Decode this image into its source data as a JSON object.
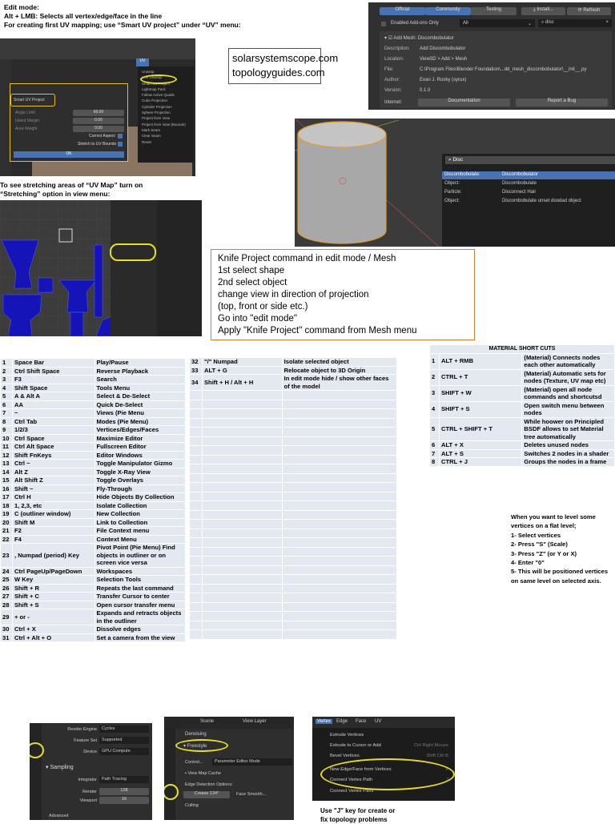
{
  "intro": {
    "line1": "Edit mode:",
    "line2": "Alt + LMB: Selects all vertex/edge/face in the line",
    "line3": "For creating first UV mapping; use  “Smart UV project” under “UV” menu:"
  },
  "uv_shot": {
    "panel_title": "Smart UV Project",
    "fields": [
      {
        "label": "Angle Limit",
        "value": "66.00"
      },
      {
        "label": "Island Margin",
        "value": "0.00"
      },
      {
        "label": "Area Weight",
        "value": "0.00"
      }
    ],
    "correct_aspect": "Correct Aspect",
    "stretch": "Stretch to UV Bounds",
    "ok": "OK",
    "menu": [
      "Unwrap",
      "Live Unwrap",
      "Smart UV Project",
      "Lightmap Pack",
      "Follow Active Quads",
      "Cube Projection",
      "Cylinder Projection",
      "Sphere Projection",
      "Project from View",
      "Project from View (Bounds)",
      "Mark Seam",
      "Clear Seam",
      "Reset"
    ],
    "menu_tab": "UV"
  },
  "links": [
    "solarsystemscope.com",
    "topologyguides.com"
  ],
  "addon": {
    "tabs": [
      "Official",
      "Community",
      "Testing"
    ],
    "install": "Install...",
    "refresh": "Refresh",
    "enabled_only": "Enabled Add-ons Only",
    "filter": "All",
    "search": "disc",
    "name": "Add Mesh: Discombobulator",
    "rows": [
      {
        "k": "Description:",
        "v": "Add Discombobulator"
      },
      {
        "k": "Location:",
        "v": "View3D > Add > Mesh"
      },
      {
        "k": "File:",
        "v": "C:\\Program Files\\Blender Foundation\\...dd_mesh_discombobulator\\__init__.py"
      },
      {
        "k": "Author:",
        "v": "Evan J. Rosky (syrux)"
      },
      {
        "k": "Version:",
        "v": "0.1.0"
      }
    ],
    "internet": "Internet:",
    "doc": "Documentation",
    "bug": "Report a Bug"
  },
  "search_shot": {
    "query": "Disc",
    "results": [
      {
        "k": "Discombobulate:",
        "v": "Discombobulator"
      },
      {
        "k": "Object:",
        "v": "Discombobulate"
      },
      {
        "k": "Particle:",
        "v": "Disconnect Hair"
      },
      {
        "k": "Object:",
        "v": "Discombobulate unset doodad object"
      }
    ]
  },
  "stretch_note": {
    "line1": "To see stretching areas of “UV Map” turn on",
    "line2": "“Stretching” option in view menu:"
  },
  "knife": [
    "Knife Project command in edit mode / Mesh",
    "1st select shape",
    "2nd select object",
    "change view in direction of projection",
    "(top, front or side etc.)",
    "Go into \"edit mode\"",
    "Apply \"Knife Project\" command from Mesh menu"
  ],
  "shortcuts": [
    [
      "1",
      "Space Bar",
      "Play/Pause"
    ],
    [
      "2",
      "Ctrl Shift Space",
      "Reverse Playback"
    ],
    [
      "3",
      "F3",
      "Search"
    ],
    [
      "4",
      "Shift Space",
      "Tools Menu"
    ],
    [
      "5",
      "A & Alt A",
      "Select & De-Select"
    ],
    [
      "6",
      "AA",
      "Quick De-Select"
    ],
    [
      "7",
      "~",
      "Views (Pie Menu"
    ],
    [
      "8",
      "Ctrl Tab",
      "Modes (Pie Menu)"
    ],
    [
      "9",
      "1/2/3",
      "Vertices/Edges/Faces"
    ],
    [
      "10",
      "Ctrl Space",
      "Maximize Editor"
    ],
    [
      "11",
      "Ctrl Alt Space",
      "Fullscreen Editor"
    ],
    [
      "12",
      "Shift FnKeys",
      "Editor Windows"
    ],
    [
      "13",
      "Ctrl ~",
      "Toggle Manipulator Gizmo"
    ],
    [
      "14",
      "Alt Z",
      "Toggle X-Ray View"
    ],
    [
      "15",
      "Alt Shift Z",
      "Toggle Overlays"
    ],
    [
      "16",
      "Shift ~",
      "Fly-Through"
    ],
    [
      "17",
      "Ctrl H",
      "Hide Objects By Collection"
    ],
    [
      "18",
      "1, 2,3, etc",
      "Isolate Collection"
    ],
    [
      "19",
      "C (outliner window)",
      "New Collection"
    ],
    [
      "20",
      "Shift M",
      "Link to Collection"
    ],
    [
      "21",
      "F2",
      "File Context menu"
    ],
    [
      "22",
      "F4",
      "Context Menu"
    ],
    [
      "23",
      ", Numpad (period) Key",
      "Pivot Point (Pie Menu) Find objects in outliner or on screen vice versa"
    ],
    [
      "24",
      "Ctrl PageUp/PageDown",
      "Workspaces"
    ],
    [
      "25",
      "W Key",
      "Selection Tools"
    ],
    [
      "26",
      "Shift + R",
      "Repeats the last command"
    ],
    [
      "27",
      "Shift + C",
      "Transfer Cursor to center"
    ],
    [
      "28",
      "Shift + S",
      "Open cursor transfer menu"
    ],
    [
      "29",
      "+ or -",
      "Expands and retracts objects in the outliner"
    ],
    [
      "30",
      "Ctrl + X",
      "Dissolve edges"
    ],
    [
      "31",
      "Ctrl + Alt + O",
      "Set a camera from the view"
    ]
  ],
  "shortcuts2": [
    [
      "32",
      "\"/\" Numpad",
      "Isolate selected object"
    ],
    [
      "33",
      "ALT + G",
      "Relocate object to 3D Origin"
    ],
    [
      "34",
      "Shift + H / Alt + H",
      "In edit mode hide / show other faces of the model"
    ]
  ],
  "material": {
    "title": "MATERIAL SHORT CUTS",
    "rows": [
      [
        "1",
        "ALT + RMB",
        "(Material) Connects nodes each other automatically"
      ],
      [
        "2",
        "CTRL + T",
        "(Material) Automatic sets for nodes (Texture, UV map etc)"
      ],
      [
        "3",
        "SHIFT + W",
        "(Material) open all node commands and shortcutsd"
      ],
      [
        "4",
        "SHIFT + S",
        "Open switch menu between nodes"
      ],
      [
        "5",
        "CTRL + SHIFT + T",
        "While hoower on Principled BSDF allows to set Material tree automatically"
      ],
      [
        "6",
        "ALT + X",
        "Deletes unused nodes"
      ],
      [
        "7",
        "ALT + S",
        "Switches 2 nodes in a shader"
      ],
      [
        "8",
        "CTRL + J",
        "Groups the nodes in a frame"
      ]
    ]
  },
  "level_note": [
    "When you want to level some vertices on a flat level;",
    "1- Select vertices",
    "2- Press \"S\" (Scale)",
    "3- Press \"Z\" (or Y or X)",
    "4- Enter \"0\"",
    "5- This will be positioned vertices on same level on selected axis."
  ],
  "render_shot": {
    "rows": [
      {
        "k": "Render Engine",
        "v": "Cycles"
      },
      {
        "k": "Feature Set",
        "v": "Supported"
      },
      {
        "k": "Device",
        "v": "GPU Compute"
      }
    ],
    "section": "Sampling",
    "integrator_k": "Integrator",
    "integrator_v": "Path Tracing",
    "render_k": "Render",
    "render_v": "128",
    "viewport_k": "Viewport",
    "viewport_v": "16",
    "advanced": "Advanced"
  },
  "freestyle_shot": {
    "scene": "Scene",
    "view_layer": "View Layer",
    "denoising": "Denoising",
    "freestyle": "Freestyle",
    "control": "Control...",
    "mode": "Parameter Editor Mode",
    "cache": "View Map Cache",
    "edge": "Edge Detection Options:",
    "crease": "Crease    134°",
    "smooth": "Face Smooth...",
    "culling": "Culling"
  },
  "vertex_shot": {
    "tabs": [
      "Vertex",
      "Edge",
      "Face",
      "UV"
    ],
    "items": [
      {
        "k": "Extrude Vertices",
        "v": ""
      },
      {
        "k": "Extrude to Cursor or Add",
        "v": "Ctrl Right Mouse"
      },
      {
        "k": "Bevel Vertices",
        "v": "Shift Ctrl B"
      },
      {
        "k": "New Edge/Face from Vertices",
        "v": "F"
      },
      {
        "k": "Connect Vertex Path",
        "v": "J"
      },
      {
        "k": "Connect Vertex Pairs",
        "v": ""
      }
    ]
  },
  "j_note": [
    "Use \"J\" key for create or",
    "fix topology problems"
  ],
  "colors": {
    "highlight": "#e8e01c",
    "knife_border": "#e07b2a",
    "blender_blue": "#4772b3",
    "table_bg": "#e4e8f0"
  }
}
